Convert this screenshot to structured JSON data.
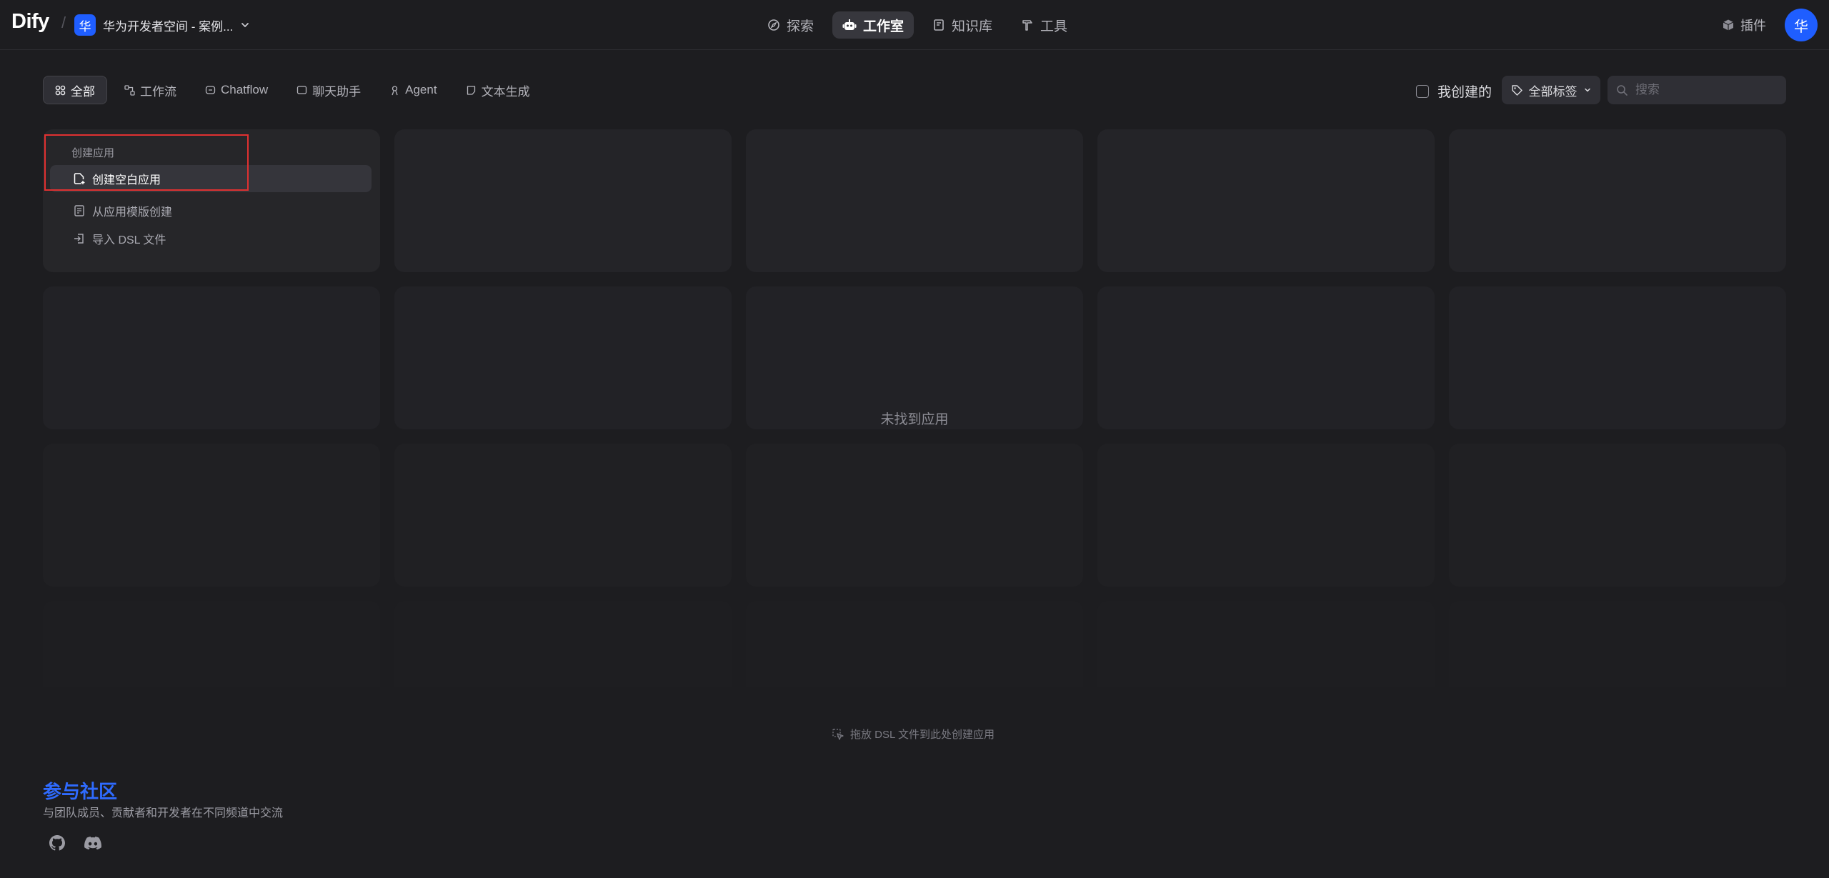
{
  "header": {
    "logo": "Dify",
    "separator": "/",
    "workspace": {
      "avatar": "华",
      "name": "华为开发者空间 - 案例..."
    },
    "nav": [
      {
        "label": "探索",
        "icon": "compass-icon"
      },
      {
        "label": "工作室",
        "icon": "robot-icon",
        "active": true
      },
      {
        "label": "知识库",
        "icon": "book-icon"
      },
      {
        "label": "工具",
        "icon": "hammer-icon"
      }
    ],
    "plugins_label": "插件",
    "user_avatar": "华"
  },
  "filters": {
    "tabs": [
      {
        "label": "全部",
        "icon": "grid-icon",
        "active": true
      },
      {
        "label": "工作流",
        "icon": "workflow-icon"
      },
      {
        "label": "Chatflow",
        "icon": "chat-bubble-icon"
      },
      {
        "label": "聊天助手",
        "icon": "message-icon"
      },
      {
        "label": "Agent",
        "icon": "agent-icon"
      },
      {
        "label": "文本生成",
        "icon": "document-icon"
      }
    ],
    "created_by_me": "我创建的",
    "all_tags": "全部标签",
    "search_placeholder": "搜索"
  },
  "create_app": {
    "title": "创建应用",
    "items": [
      {
        "label": "创建空白应用",
        "icon": "new-file-icon"
      },
      {
        "label": "从应用模版创建",
        "icon": "template-icon"
      },
      {
        "label": "导入 DSL 文件",
        "icon": "import-icon"
      }
    ]
  },
  "empty_state": "未找到应用",
  "drop_hint": "拖放 DSL 文件到此处创建应用",
  "community": {
    "title": "参与社区",
    "description": "与团队成员、贡献者和开发者在不同频道中交流"
  },
  "colors": {
    "background": "#1d1d20",
    "accent": "#1f5eff",
    "highlight_box": "#e03131",
    "community_title": "#2f6bff"
  }
}
